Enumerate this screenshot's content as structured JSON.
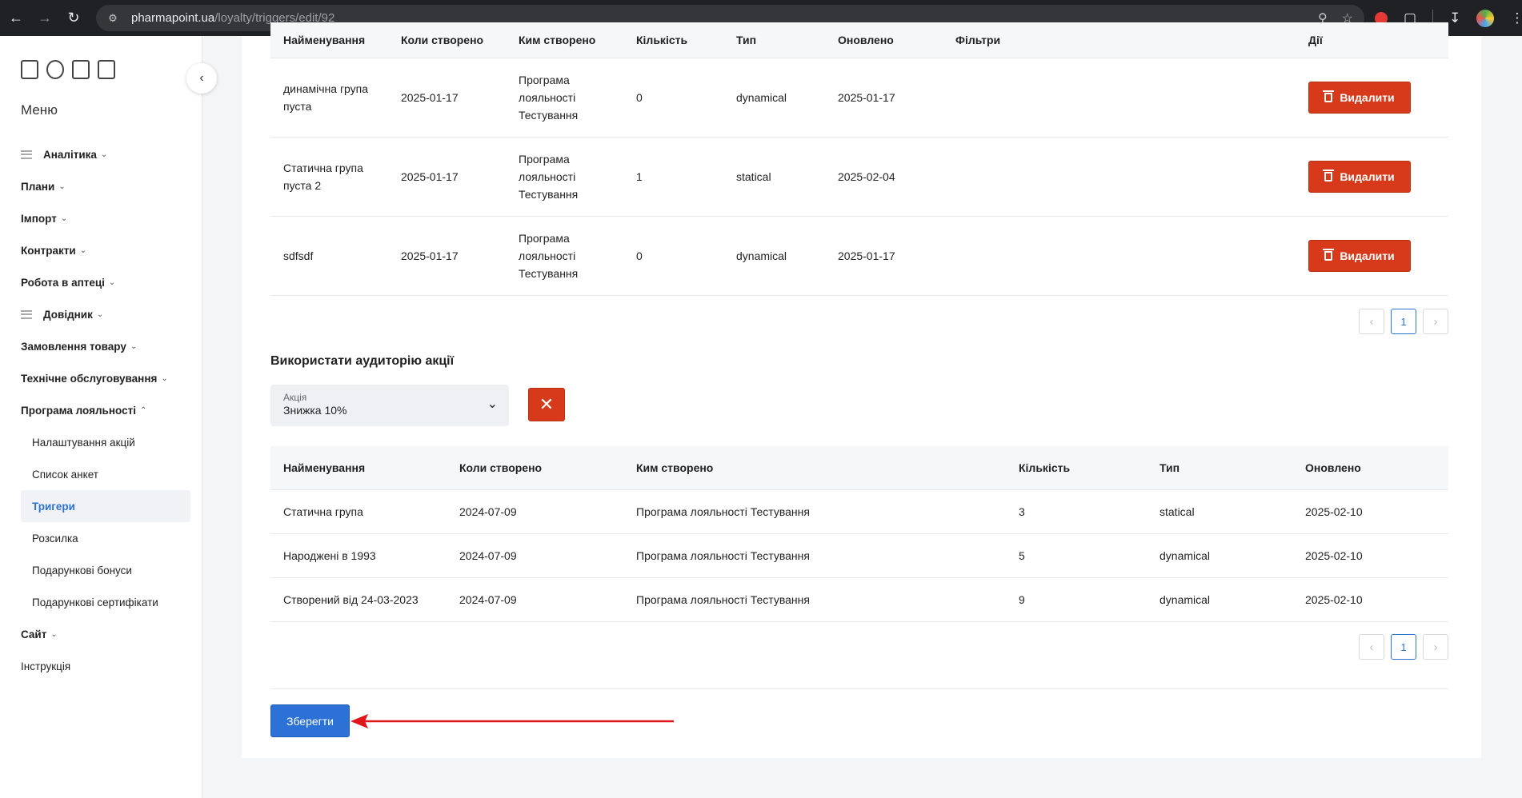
{
  "browser": {
    "url_host": "pharmapoint.ua",
    "url_path": "/loyalty/triggers/edit/92"
  },
  "sidebar": {
    "menu_title": "Меню",
    "items": [
      {
        "label": "Аналітика",
        "has_icon": true,
        "expanded": false
      },
      {
        "label": "Плани",
        "has_icon": false,
        "expanded": false
      },
      {
        "label": "Імпорт",
        "has_icon": false,
        "expanded": false
      },
      {
        "label": "Контракти",
        "has_icon": false,
        "expanded": false
      },
      {
        "label": "Робота в аптеці",
        "has_icon": false,
        "expanded": false
      },
      {
        "label": "Довідник",
        "has_icon": true,
        "expanded": false
      },
      {
        "label": "Замовлення товару",
        "has_icon": false,
        "expanded": false
      },
      {
        "label": "Технічне обслуговування",
        "has_icon": false,
        "expanded": false
      },
      {
        "label": "Програма лояльності",
        "has_icon": false,
        "expanded": true
      }
    ],
    "loyalty_subitems": [
      {
        "label": "Налаштування акцій",
        "active": false
      },
      {
        "label": "Список анкет",
        "active": false
      },
      {
        "label": "Тригери",
        "active": true
      },
      {
        "label": "Розсилка",
        "active": false
      },
      {
        "label": "Подарункові бонуси",
        "active": false
      },
      {
        "label": "Подарункові сертифікати",
        "active": false
      }
    ],
    "after_items": [
      {
        "label": "Сайт",
        "chevron": true
      },
      {
        "label": "Інструкція",
        "chevron": false
      }
    ]
  },
  "groups_table": {
    "headers": [
      "Найменування",
      "Коли створено",
      "Ким створено",
      "Кількість",
      "Тип",
      "Оновлено",
      "Фільтри",
      "Дії"
    ],
    "rows": [
      {
        "name": "динамічна група пуста",
        "created": "2025-01-17",
        "author": "Програма лояльності Тестування",
        "count": "0",
        "type": "dynamical",
        "updated": "2025-01-17",
        "filters": "",
        "action": "Видалити"
      },
      {
        "name": "Статична група пуста 2",
        "created": "2025-01-17",
        "author": "Програма лояльності Тестування",
        "count": "1",
        "type": "statical",
        "updated": "2025-02-04",
        "filters": "",
        "action": "Видалити"
      },
      {
        "name": "sdfsdf",
        "created": "2025-01-17",
        "author": "Програма лояльності Тестування",
        "count": "0",
        "type": "dynamical",
        "updated": "2025-01-17",
        "filters": "",
        "action": "Видалити"
      }
    ],
    "page": "1"
  },
  "audience": {
    "title": "Використати аудиторію акції",
    "select_label": "Акція",
    "select_value": "Знижка 10%"
  },
  "audience_table": {
    "headers": [
      "Найменування",
      "Коли створено",
      "Ким створено",
      "Кількість",
      "Тип",
      "Оновлено"
    ],
    "rows": [
      {
        "name": "Статична група",
        "created": "2024-07-09",
        "author": "Програма лояльності Тестування",
        "count": "3",
        "type": "statical",
        "updated": "2025-02-10"
      },
      {
        "name": "Народжені в 1993",
        "created": "2024-07-09",
        "author": "Програма лояльності Тестування",
        "count": "5",
        "type": "dynamical",
        "updated": "2025-02-10"
      },
      {
        "name": "Створений від 24-03-2023",
        "created": "2024-07-09",
        "author": "Програма лояльності Тестування",
        "count": "9",
        "type": "dynamical",
        "updated": "2025-02-10"
      }
    ],
    "page": "1"
  },
  "actions": {
    "save_label": "Зберегти"
  },
  "colors": {
    "primary": "#2c72d6",
    "danger": "#d63a1a",
    "annotation_arrow": "#e0161b"
  }
}
